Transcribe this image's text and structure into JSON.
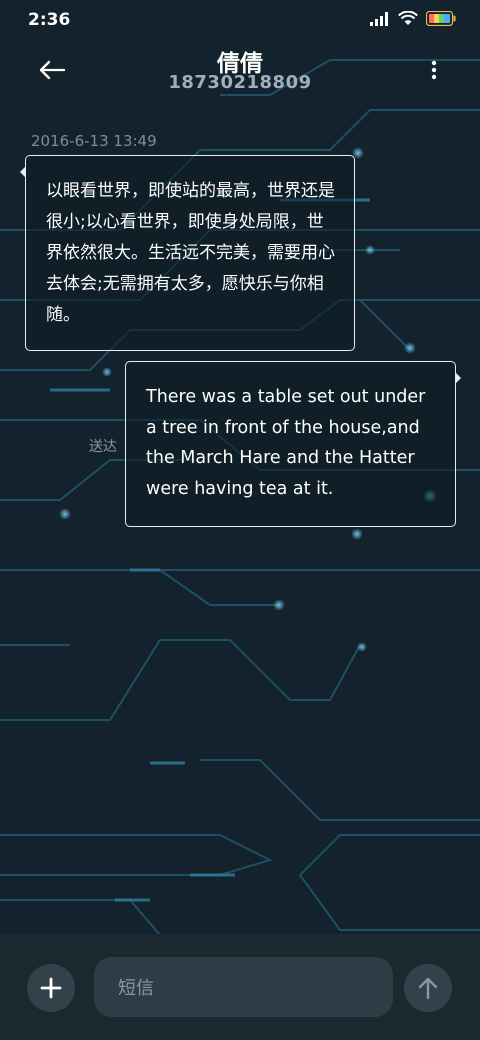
{
  "status_bar": {
    "time": "2:36",
    "icons": [
      "signal-icon",
      "wifi-icon",
      "battery-icon"
    ]
  },
  "header": {
    "title": "倩倩",
    "subtitle": "18730218809",
    "back_icon": "back-arrow-icon",
    "more_icon": "more-vertical-icon"
  },
  "conversation": {
    "timestamp": "2016-6-13 13:49",
    "incoming_message": "以眼看世界，即使站的最高，世界还是很小;以心看世界，即使身处局限，世界依然很大。生活远不完美，需要用心去体会;无需拥有太多，愿快乐与你相随。",
    "outgoing_message": "There was a table set out under a tree in front of the house,and the March Hare and the Hatter were having tea at it.",
    "delivery_status": "送达"
  },
  "composer": {
    "placeholder": "短信",
    "add_icon": "plus-icon",
    "send_icon": "send-arrow-icon"
  },
  "colors": {
    "background": "#13222c",
    "circuit_lines": "#1f5f78",
    "circuit_glow": "#4fb3e0",
    "bubble_border": "#e8eef2",
    "composer_bg": "#1b2830",
    "input_bg": "#2e3c45",
    "button_bg": "#33414a"
  }
}
